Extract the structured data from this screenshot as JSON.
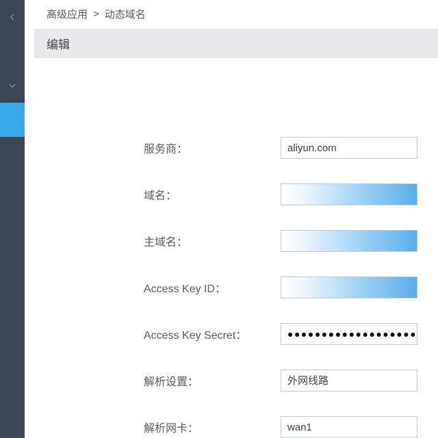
{
  "breadcrumb": {
    "parent": "高级应用",
    "separator": ">",
    "current": "动态域名"
  },
  "section_title": "编辑",
  "form": {
    "provider": {
      "label": "服务商：",
      "value": "aliyun.com"
    },
    "domain": {
      "label": "域名：",
      "value": ""
    },
    "main_domain": {
      "label": "主域名：",
      "value": ""
    },
    "access_key_id": {
      "label": "Access Key ID：",
      "value": ""
    },
    "access_key_secret": {
      "label": "Access Key Secret：",
      "value": "●●●●●●●●●●●●●●●●●●●●●●●"
    },
    "resolve_setting": {
      "label": "解析设置：",
      "value": "外网线路"
    },
    "resolve_nic": {
      "label": "解析网卡：",
      "value": "wan1"
    }
  }
}
